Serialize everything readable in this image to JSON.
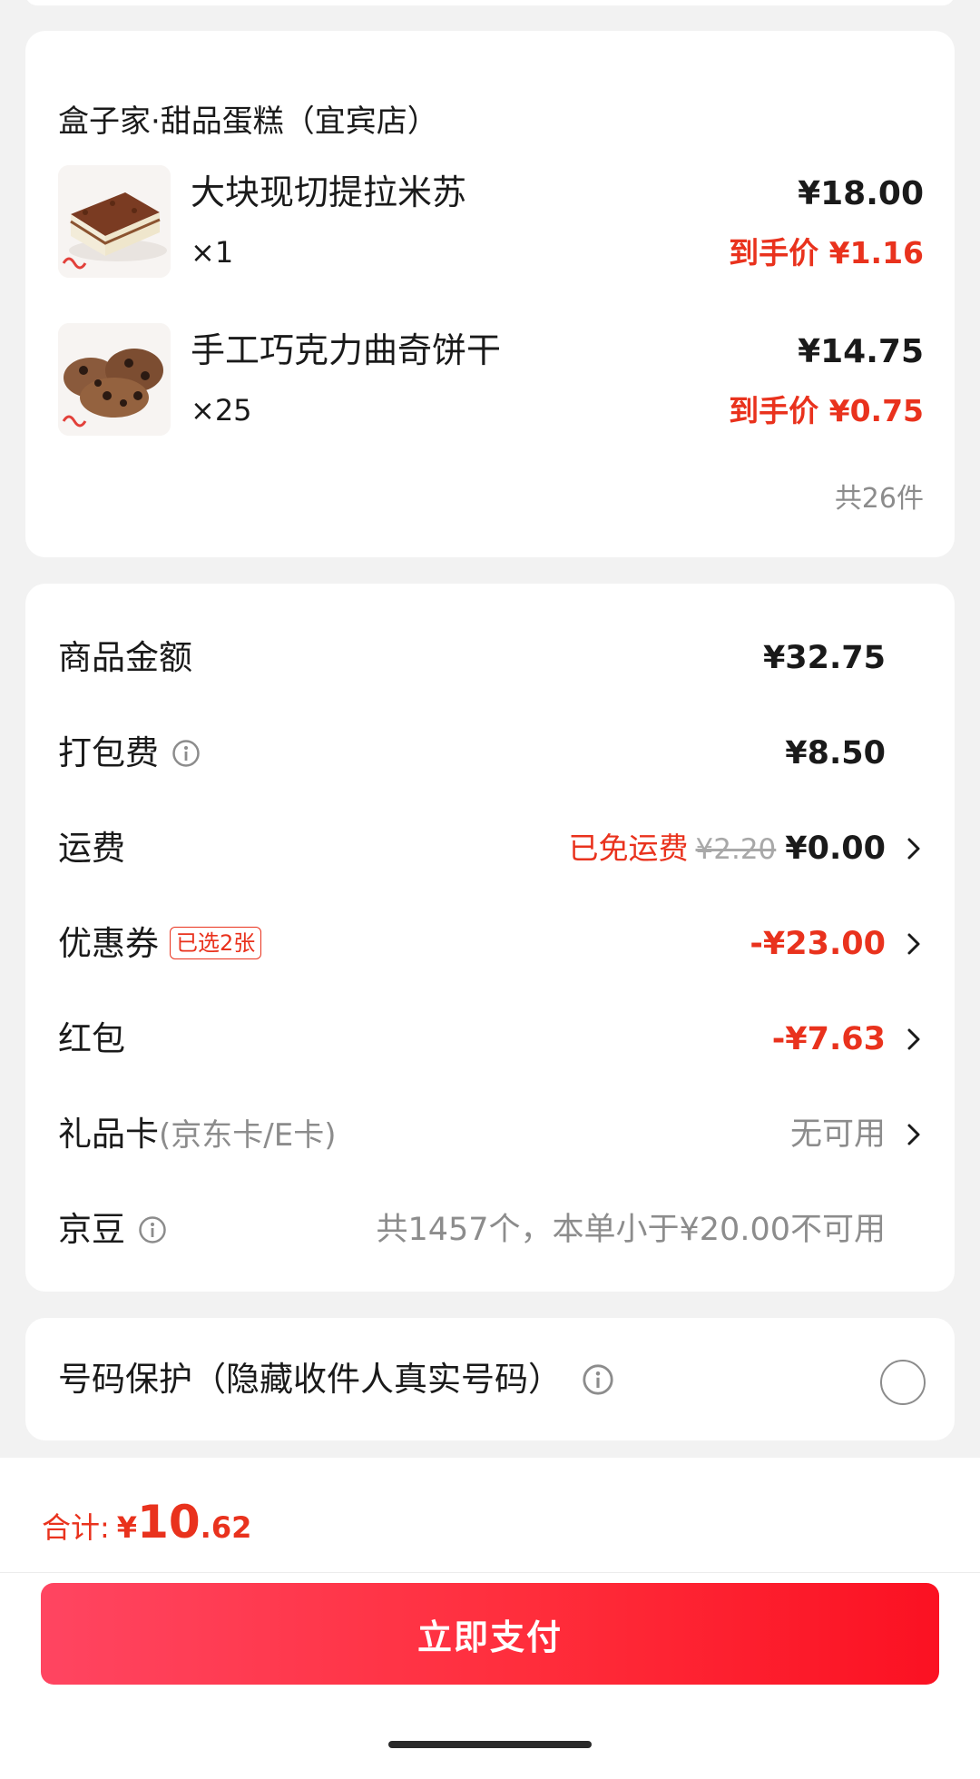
{
  "shop": {
    "name": "盒子家·甜品蛋糕（宜宾店）",
    "items": [
      {
        "name": "大块现切提拉米苏",
        "qty": "×1",
        "price": "¥18.00",
        "final_label": "到手价",
        "final_price": "¥1.16",
        "icon": "tiramisu-image"
      },
      {
        "name": "手工巧克力曲奇饼干",
        "qty": "×25",
        "price": "¥14.75",
        "final_label": "到手价",
        "final_price": "¥0.75",
        "icon": "cookie-image"
      }
    ],
    "total_count": "共26件"
  },
  "fees": {
    "goods_amount": {
      "label": "商品金额",
      "value": "¥32.75"
    },
    "packing_fee": {
      "label": "打包费",
      "value": "¥8.50"
    },
    "shipping": {
      "label": "运费",
      "free_tag": "已免运费",
      "original": "¥2.20",
      "value": "¥0.00"
    },
    "coupon": {
      "label": "优惠券",
      "tag": "已选2张",
      "value": "-¥23.00"
    },
    "red_packet": {
      "label": "红包",
      "value": "-¥7.63"
    },
    "gift_card": {
      "label": "礼品卡",
      "sub": "(京东卡/E卡)",
      "value": "无可用"
    },
    "beans": {
      "label": "京豆",
      "value": "共1457个，本单小于¥20.00不可用"
    }
  },
  "privacy": {
    "label": "号码保护（隐藏收件人真实号码）"
  },
  "footer": {
    "total_label": "合计:",
    "total_yen": "¥",
    "total_int": "10",
    "total_dec": ".62",
    "pay_label": "立即支付"
  },
  "colors": {
    "accent": "#e9321d",
    "button_start": "#ff4561",
    "button_end": "#fb1122"
  }
}
